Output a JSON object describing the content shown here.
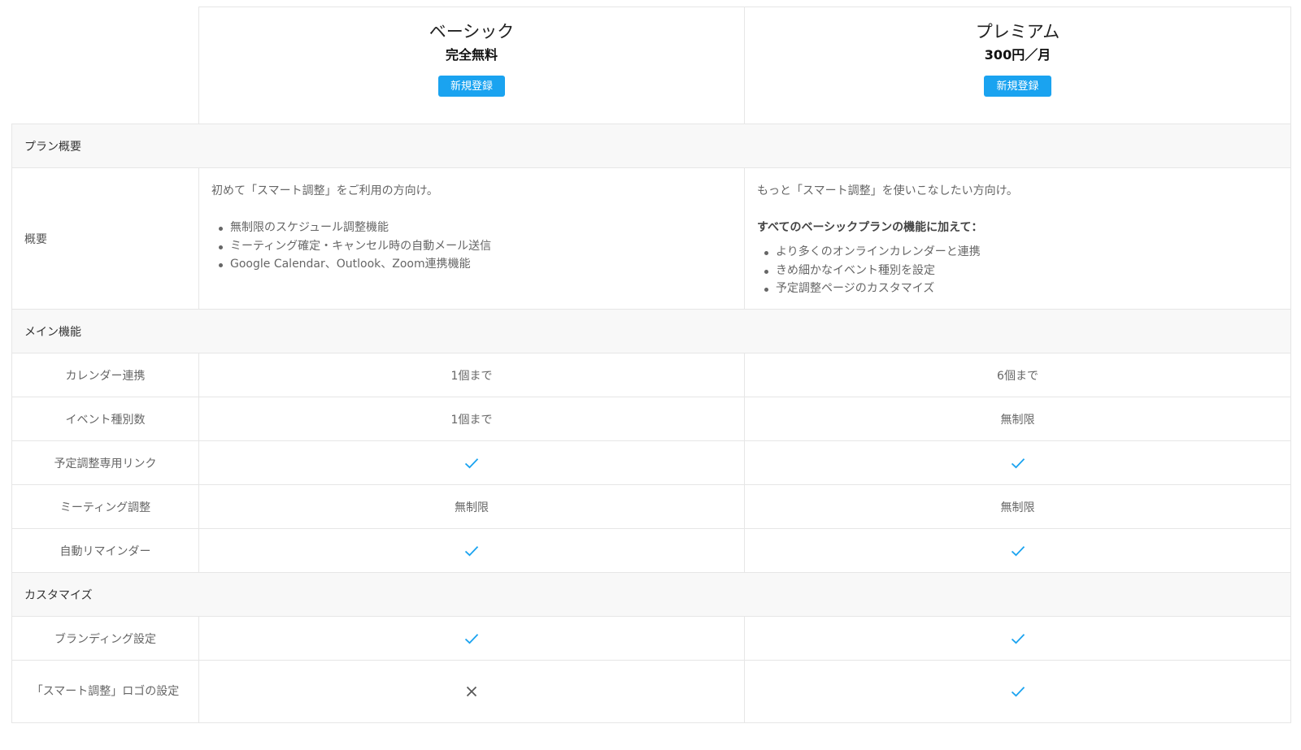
{
  "plans": [
    {
      "name": "ベーシック",
      "price": "完全無料",
      "signup_label": "新規登録"
    },
    {
      "name": "プレミアム",
      "price": "300円／月",
      "signup_label": "新規登録"
    }
  ],
  "sections": {
    "overview": "プラン概要",
    "main": "メイン機能",
    "custom": "カスタマイズ"
  },
  "summary": {
    "label": "概要",
    "basic": {
      "lead": "初めて「スマート調整」をご利用の方向け。",
      "items": [
        "無制限のスケジュール調整機能",
        "ミーティング確定・キャンセル時の自動メール送信",
        "Google Calendar、Outlook、Zoom連携機能"
      ]
    },
    "premium": {
      "lead": "もっと「スマート調整」を使いこなしたい方向け。",
      "bold": "すべてのベーシックプランの機能に加えて：",
      "items": [
        "より多くのオンラインカレンダーと連携",
        "きめ細かなイベント種別を設定",
        "予定調整ページのカスタマイズ"
      ]
    }
  },
  "features": {
    "calendar": {
      "label": "カレンダー連携",
      "basic": "1個まで",
      "premium": "6個まで"
    },
    "event_types": {
      "label": "イベント種別数",
      "basic": "1個まで",
      "premium": "無制限"
    },
    "link": {
      "label": "予定調整専用リンク",
      "basic": "check",
      "premium": "check"
    },
    "meeting": {
      "label": "ミーティング調整",
      "basic": "無制限",
      "premium": "無制限"
    },
    "reminder": {
      "label": "自動リマインダー",
      "basic": "check",
      "premium": "check"
    },
    "branding": {
      "label": "ブランディング設定",
      "basic": "check",
      "premium": "check"
    },
    "logo": {
      "label": "「スマート調整」ロゴの設定",
      "basic": "cross",
      "premium": "check"
    }
  },
  "colors": {
    "accent": "#1aa3f0",
    "check": "#1aa3f0",
    "cross": "#555555",
    "section_bg": "#f8f8f8",
    "border": "#e6e6e6"
  }
}
